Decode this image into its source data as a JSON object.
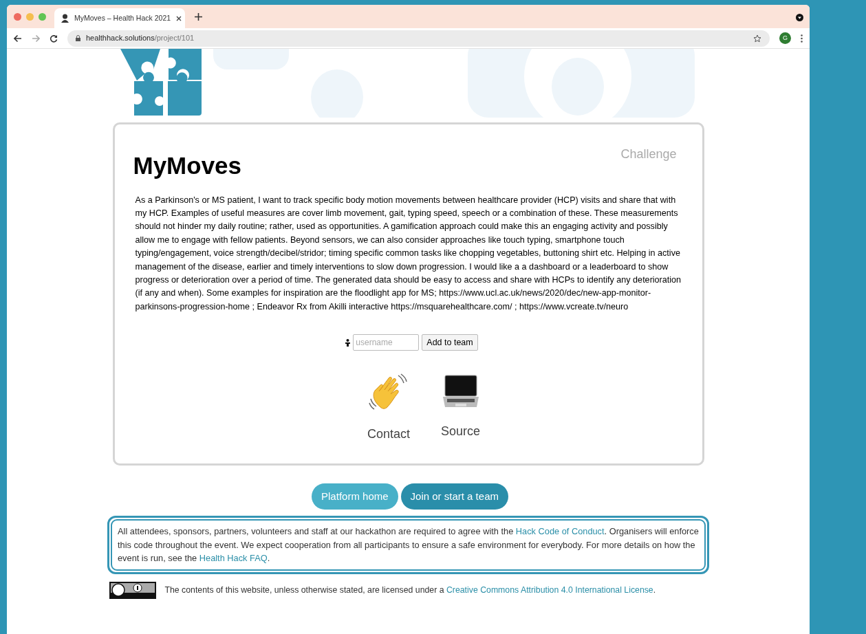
{
  "browser": {
    "tab_title": "MyMoves – Health Hack 2021",
    "url_host": "healthhack.solutions",
    "url_path": "/project/101",
    "profile_initial": "G"
  },
  "project": {
    "title": "MyMoves",
    "category": "Challenge",
    "description": "As a Parkinson's or MS patient, I want to track specific body motion movements between healthcare provider (HCP) visits and share that with my HCP. Examples of useful measures are cover limb movement, gait, typing speed, speech or a combination of these. These measurements should not hinder my daily routine; rather, used as opportunities. A gamification approach could make this an engaging activity and possibly allow me to engage with fellow patients. Beyond sensors, we can also consider approaches like touch typing, smartphone touch typing/engagement, voice strength/decibel/stridor; timing specific common tasks like chopping vegetables, buttoning shirt etc. Helping in active management of the disease, earlier and timely interventions to slow down progression. I would like a a dashboard or a leaderboard to show progress or deterioration over a period of time. The generated data should be easy to access and share with HCPs to identify any deterioration (if any and when). Some examples for inspiration are the floodlight app for MS; https://www.ucl.ac.uk/news/2020/dec/new-app-monitor-parkinsons-progression-home ; Endeavor Rx from Akilli interactive https://msquarehealthcare.com/ ; https://www.vcreate.tv/neuro",
    "team_input": {
      "placeholder": "username",
      "button": "Add to team"
    },
    "actions": [
      {
        "kind": "wave",
        "label": "Contact"
      },
      {
        "kind": "laptop",
        "label": "Source"
      }
    ]
  },
  "nav_buttons": [
    {
      "label": "Platform home",
      "selected": false
    },
    {
      "label": "Join or start a team",
      "selected": true
    }
  ],
  "notice": [
    {
      "kind": "text",
      "text": "All attendees, sponsors, partners, volunteers and staff at our hackathon are required to agree with the "
    },
    {
      "kind": "link",
      "text": "Hack Code of Conduct"
    },
    {
      "kind": "text",
      "text": ". Organisers will enforce this code throughout the event. We expect cooperation from all participants to ensure a safe environment for everybody. For more details on how the event is run, see the "
    },
    {
      "kind": "link",
      "text": "Health Hack FAQ"
    },
    {
      "kind": "text",
      "text": "."
    }
  ],
  "license": [
    {
      "kind": "text",
      "text": "The contents of this website, unless otherwise stated, are licensed under a "
    },
    {
      "kind": "link",
      "text": "Creative Commons Attribution 4.0 International License"
    },
    {
      "kind": "text",
      "text": "."
    }
  ]
}
